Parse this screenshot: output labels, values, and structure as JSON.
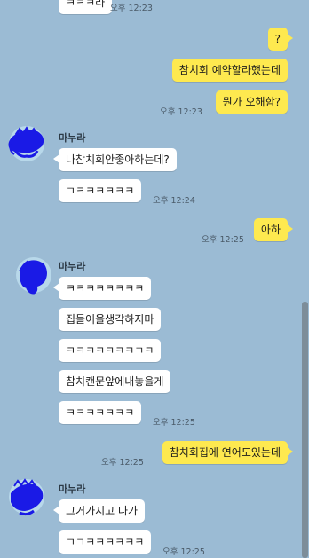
{
  "sender_name": "마누라",
  "messages": {
    "m0": {
      "text": "ㅋㅋㅋ라",
      "time": "오후 12:23"
    },
    "m1": {
      "text": "?"
    },
    "m2": {
      "text": "참치회 예약할라했는데"
    },
    "m3": {
      "text": "뭔가 오해함?",
      "time": "오후 12:23"
    },
    "m4": {
      "text": "나참치회안좋아하는데?"
    },
    "m5": {
      "text": "ㄱㅋㅋㅋㅋㅋㅋ",
      "time": "오후 12:24"
    },
    "m6": {
      "text": "아하",
      "time": "오후 12:25"
    },
    "m7": {
      "text": "ㅋㅋㅋㅋㅋㅋㅋㅋ"
    },
    "m8": {
      "text": "집들어올생각하지마"
    },
    "m9": {
      "text": "ㅋㅋㅋㅋㅋㅋㅋㄱㅋ"
    },
    "m10": {
      "text": "참치캔문앞에내놓을게"
    },
    "m11": {
      "text": "ㅋㅋㅋㅋㅋㅋㅋ",
      "time": "오후 12:25"
    },
    "m12": {
      "text": "참치회집에 연어도있는데",
      "time": "오후 12:25"
    },
    "m13": {
      "text": "그거가지고 나가"
    },
    "m14": {
      "text": "ㄱㄱㅋㅋㅋㅋㅋㅋ",
      "time": "오후 12:25"
    }
  },
  "colors": {
    "background": "#9bbbd4",
    "incoming_bubble": "#ffffff",
    "outgoing_bubble": "#fee94f",
    "avatar_scribble": "#1a1ae6"
  }
}
